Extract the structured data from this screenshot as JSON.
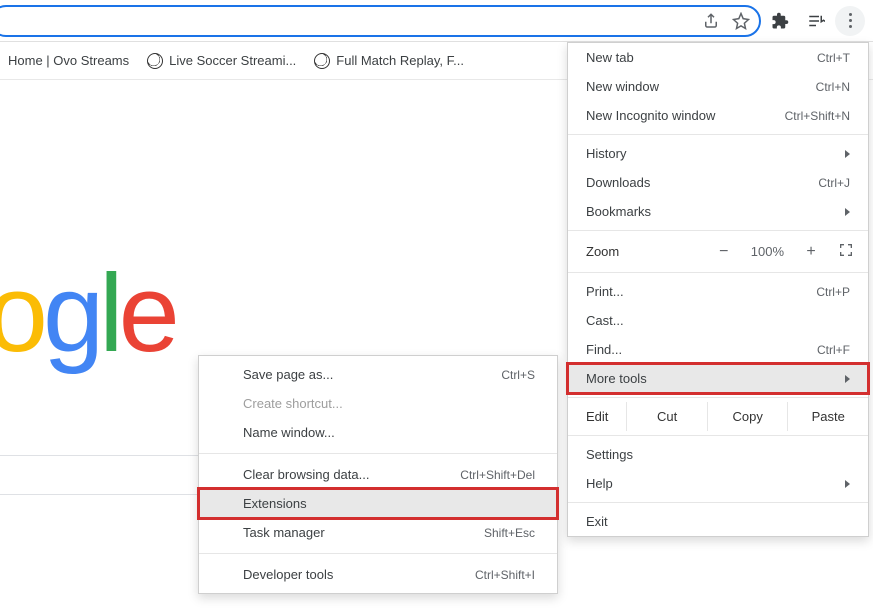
{
  "omnibox": {
    "value": ""
  },
  "bookmarks": {
    "items": [
      {
        "label": "Home | Ovo Streams",
        "icon": "none"
      },
      {
        "label": "Live Soccer Streami...",
        "icon": "soccer"
      },
      {
        "label": "Full Match Replay, F...",
        "icon": "soccer"
      }
    ]
  },
  "logo": {
    "partial": "gle"
  },
  "menu": {
    "new_tab": {
      "label": "New tab",
      "shortcut": "Ctrl+T"
    },
    "new_window": {
      "label": "New window",
      "shortcut": "Ctrl+N"
    },
    "incognito": {
      "label": "New Incognito window",
      "shortcut": "Ctrl+Shift+N"
    },
    "history": {
      "label": "History"
    },
    "downloads": {
      "label": "Downloads",
      "shortcut": "Ctrl+J"
    },
    "bookmarks": {
      "label": "Bookmarks"
    },
    "zoom": {
      "label": "Zoom",
      "value": "100%",
      "minus": "−",
      "plus": "+"
    },
    "print": {
      "label": "Print...",
      "shortcut": "Ctrl+P"
    },
    "cast": {
      "label": "Cast..."
    },
    "find": {
      "label": "Find...",
      "shortcut": "Ctrl+F"
    },
    "more_tools": {
      "label": "More tools"
    },
    "edit": {
      "label": "Edit",
      "cut": "Cut",
      "copy": "Copy",
      "paste": "Paste"
    },
    "settings": {
      "label": "Settings"
    },
    "help": {
      "label": "Help"
    },
    "exit": {
      "label": "Exit"
    }
  },
  "submenu": {
    "save_as": {
      "label": "Save page as...",
      "shortcut": "Ctrl+S"
    },
    "create_shortcut": {
      "label": "Create shortcut..."
    },
    "name_window": {
      "label": "Name window..."
    },
    "clear_data": {
      "label": "Clear browsing data...",
      "shortcut": "Ctrl+Shift+Del"
    },
    "extensions": {
      "label": "Extensions"
    },
    "task_manager": {
      "label": "Task manager",
      "shortcut": "Shift+Esc"
    },
    "developer_tools": {
      "label": "Developer tools",
      "shortcut": "Ctrl+Shift+I"
    }
  }
}
